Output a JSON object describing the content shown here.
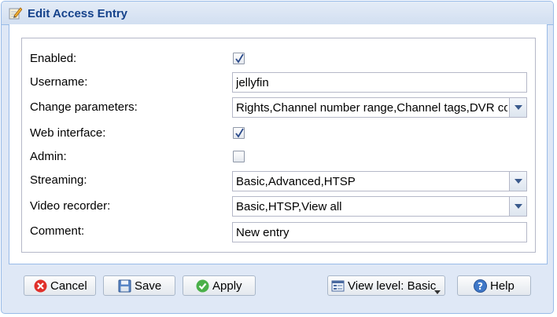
{
  "window": {
    "title": "Edit Access Entry"
  },
  "form": {
    "enabled": {
      "label": "Enabled:",
      "checked": true
    },
    "username": {
      "label": "Username:",
      "value": "jellyfin"
    },
    "change_parameters": {
      "label": "Change parameters:",
      "value": "Rights,Channel number range,Channel tags,DVR co"
    },
    "web_interface": {
      "label": "Web interface:",
      "checked": true
    },
    "admin": {
      "label": "Admin:",
      "checked": false
    },
    "streaming": {
      "label": "Streaming:",
      "value": "Basic,Advanced,HTSP"
    },
    "video_recorder": {
      "label": "Video recorder:",
      "value": "Basic,HTSP,View all"
    },
    "comment": {
      "label": "Comment:",
      "value": "New entry"
    }
  },
  "buttons": {
    "cancel": "Cancel",
    "save": "Save",
    "apply": "Apply",
    "view_level": "View level: Basic",
    "help": "Help"
  },
  "colors": {
    "title_text": "#15428b",
    "window_border": "#99bbe8",
    "window_bg": "#dfe8f6"
  }
}
